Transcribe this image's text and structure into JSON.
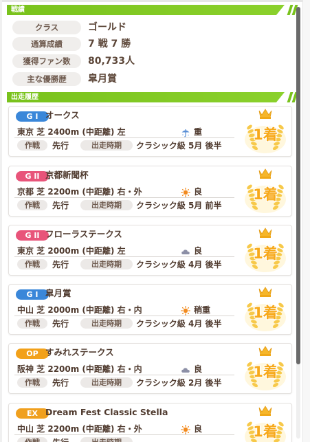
{
  "sections": {
    "record_title": "戦績",
    "history_title": "出走履歴"
  },
  "record": [
    {
      "label": "クラス",
      "value": "ゴールド"
    },
    {
      "label": "通算成績",
      "value": "7 戦 7 勝"
    },
    {
      "label": "獲得ファン数",
      "value": "80,733人"
    },
    {
      "label": "主な優勝歴",
      "value": "皐月賞"
    }
  ],
  "labels": {
    "strategy": "作戦",
    "period": "出走時期"
  },
  "races": [
    {
      "grade": "G I",
      "grade_style": "g1",
      "name": "オークス",
      "course": "東京 芝 2400m (中距離) 左",
      "weather_icon": "umbrella-icon",
      "condition": "重",
      "strategy": "先行",
      "period": "クラシック級 5月 後半",
      "place": "1着"
    },
    {
      "grade": "G II",
      "grade_style": "g2",
      "name": "京都新聞杯",
      "course": "京都 芝 2200m (中距離) 右・外",
      "weather_icon": "sun-icon",
      "condition": "良",
      "strategy": "先行",
      "period": "クラシック級 5月 前半",
      "place": "1着"
    },
    {
      "grade": "G II",
      "grade_style": "g2",
      "name": "フローラステークス",
      "course": "東京 芝 2000m (中距離) 左",
      "weather_icon": "cloud-icon",
      "condition": "良",
      "strategy": "先行",
      "period": "クラシック級 4月 後半",
      "place": "1着"
    },
    {
      "grade": "G I",
      "grade_style": "g1",
      "name": "皐月賞",
      "course": "中山 芝 2000m (中距離) 右・内",
      "weather_icon": "sun-icon",
      "condition": "稍重",
      "strategy": "先行",
      "period": "クラシック級 4月 後半",
      "place": "1着"
    },
    {
      "grade": "OP",
      "grade_style": "op",
      "name": "すみれステークス",
      "course": "阪神 芝 2200m (中距離) 右・内",
      "weather_icon": "cloud-icon",
      "condition": "良",
      "strategy": "先行",
      "period": "クラシック級 2月 後半",
      "place": "1着"
    },
    {
      "grade": "EX",
      "grade_style": "ex",
      "name": "Dream Fest Classic Stella",
      "course": "中山 芝 2200m (中距離) 右・外",
      "weather_icon": "sun-icon",
      "condition": "良",
      "strategy": "先行",
      "period": "",
      "place": "1着"
    }
  ],
  "colors": {
    "section_green": "#79c21c",
    "text_brown": "#4f3a2e",
    "gold": "#f2b320"
  }
}
